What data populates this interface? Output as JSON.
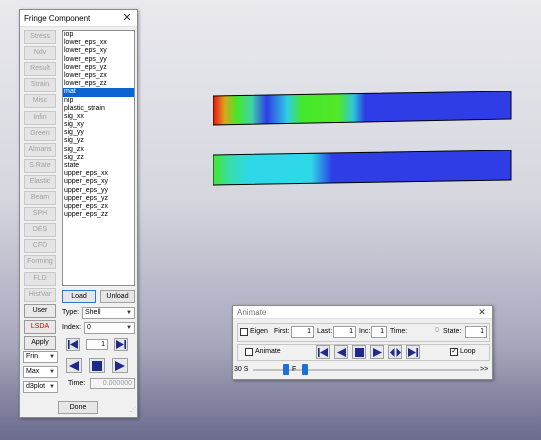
{
  "fringe": {
    "title": "Fringe Component",
    "left_buttons": [
      {
        "label": "Stress",
        "state": "disabled"
      },
      {
        "label": "Ndv",
        "state": "disabled"
      },
      {
        "label": "Result",
        "state": "disabled"
      },
      {
        "label": "Strain",
        "state": "disabled"
      },
      {
        "label": "Misc",
        "state": "disabled"
      },
      {
        "label": "Infin",
        "state": "disabled"
      },
      {
        "label": "Green",
        "state": "disabled"
      },
      {
        "label": "Almans",
        "state": "disabled"
      },
      {
        "label": "S.Rate",
        "state": "disabled"
      },
      {
        "label": "Elastic",
        "state": "disabled"
      },
      {
        "label": "Beam",
        "state": "disabled"
      },
      {
        "label": "SPH",
        "state": "disabled"
      },
      {
        "label": "DES",
        "state": "disabled"
      },
      {
        "label": "CFD",
        "state": "disabled"
      },
      {
        "label": "Forming",
        "state": "disabled"
      },
      {
        "label": "FLD",
        "state": "disabled"
      },
      {
        "label": "HistVar",
        "state": "disabled"
      },
      {
        "label": "User",
        "state": "active"
      },
      {
        "label": "LSDA",
        "state": "red"
      },
      {
        "label": "Apply",
        "state": "active"
      }
    ],
    "list_items": [
      "iop",
      "lower_eps_xx",
      "lower_eps_xy",
      "lower_eps_yy",
      "lower_eps_yz",
      "lower_eps_zx",
      "lower_eps_zz",
      "mat",
      "nip",
      "plastic_strain",
      "sig_xx",
      "sig_xy",
      "sig_yy",
      "sig_yz",
      "sig_zx",
      "sig_zz",
      "state",
      "upper_eps_xx",
      "upper_eps_xy",
      "upper_eps_yy",
      "upper_eps_yz",
      "upper_eps_zx",
      "upper_eps_zz"
    ],
    "selected_item": "mat",
    "load_label": "Load",
    "unload_label": "Unload",
    "type_label": "Type:",
    "type_value": "Shell",
    "index_label": "Index:",
    "index_value": "0",
    "frame_value": "1",
    "time_label": "Time:",
    "time_value": "0.000000",
    "fringe_combo": "Frin",
    "max_combo": "Max",
    "plot_combo": "d3plot",
    "done_label": "Done"
  },
  "animate": {
    "title": "Animate",
    "eigen_label": "Eigen",
    "eigen_checked": false,
    "first_label": "First:",
    "first_value": "1",
    "last_label": "Last:",
    "last_value": "1",
    "inc_label": "Inc:",
    "inc_value": "1",
    "time_label": "Time:",
    "time_value": "0",
    "state_label": "State:",
    "state_value": "1",
    "animate_label": "Animate",
    "animate_checked": false,
    "loop_label": "Loop",
    "loop_checked": true,
    "speed_label": "30 S",
    "f_label": "F",
    "fast_forward": ">>"
  },
  "colors": {
    "accent_select": "#0a64d2",
    "fringe_red": "#e00000",
    "fringe_green": "#44e82a",
    "fringe_blue": "#2e3de6",
    "fringe_cyan": "#2ed8e8"
  }
}
